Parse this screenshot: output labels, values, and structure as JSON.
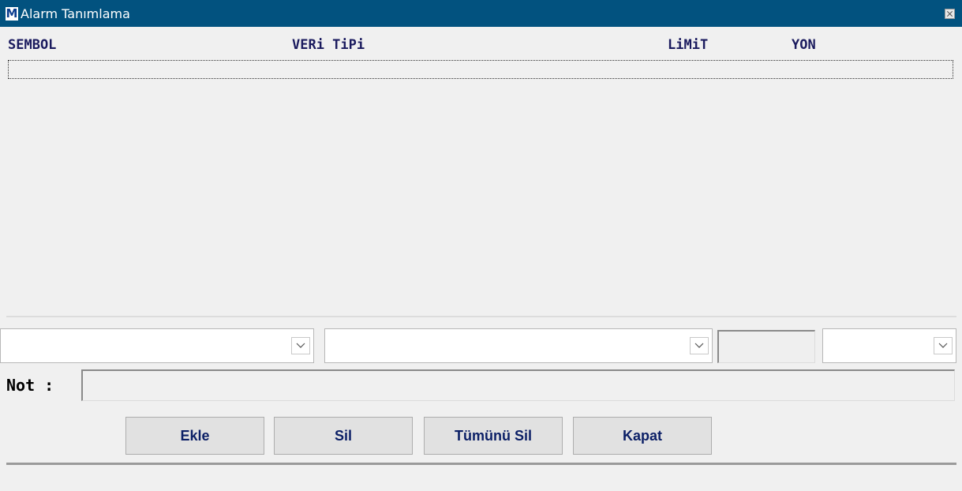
{
  "window": {
    "title": "Alarm Tanımlama",
    "app_icon_letter": "M",
    "titlebar_color": "#02527f"
  },
  "table": {
    "columns": [
      "SEMBOL",
      "VERi TiPi",
      "LiMiT",
      "YON"
    ],
    "rows": []
  },
  "inputs": {
    "symbol_value": "",
    "data_type_value": "",
    "limit_value": "",
    "direction_value": "",
    "note_label": "Not :",
    "note_value": ""
  },
  "buttons": {
    "add": "Ekle",
    "delete": "Sil",
    "delete_all": "Tümünü Sil",
    "close": "Kapat"
  },
  "icons": {
    "close": "close-icon",
    "dropdown": "chevron-down-icon"
  }
}
